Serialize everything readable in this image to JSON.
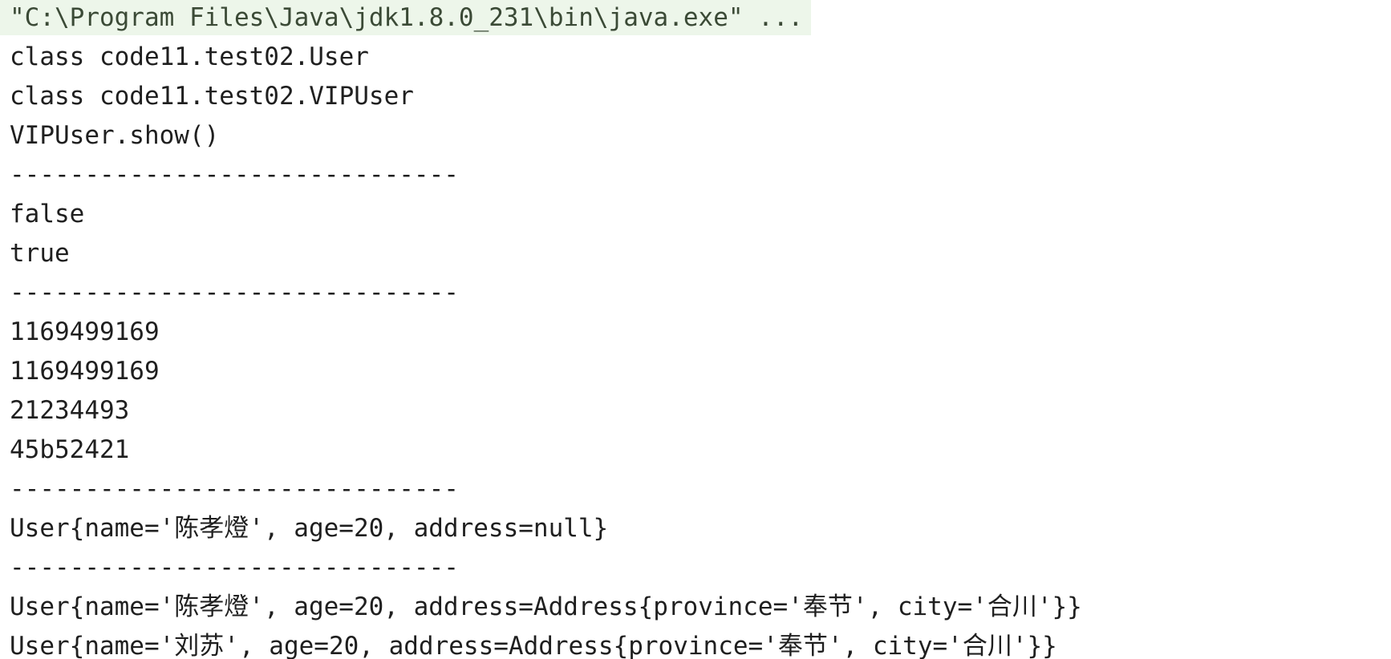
{
  "console": {
    "command": "\"C:\\Program Files\\Java\\jdk1.8.0_231\\bin\\java.exe\" ...",
    "lines": [
      "class code11.test02.User",
      "class code11.test02.VIPUser",
      "VIPUser.show()",
      "------------------------------",
      "false",
      "true",
      "------------------------------",
      "1169499169",
      "1169499169",
      "21234493",
      "45b52421",
      "------------------------------",
      "User{name='陈孝燈', age=20, address=null}",
      "------------------------------",
      "User{name='陈孝燈', age=20, address=Address{province='奉节', city='合川'}}",
      "User{name='刘苏', age=20, address=Address{province='奉节', city='合川'}}"
    ]
  },
  "colors": {
    "background": "#ffffff",
    "command_highlight": "#edf6ea",
    "text": "#1f1f1f"
  }
}
